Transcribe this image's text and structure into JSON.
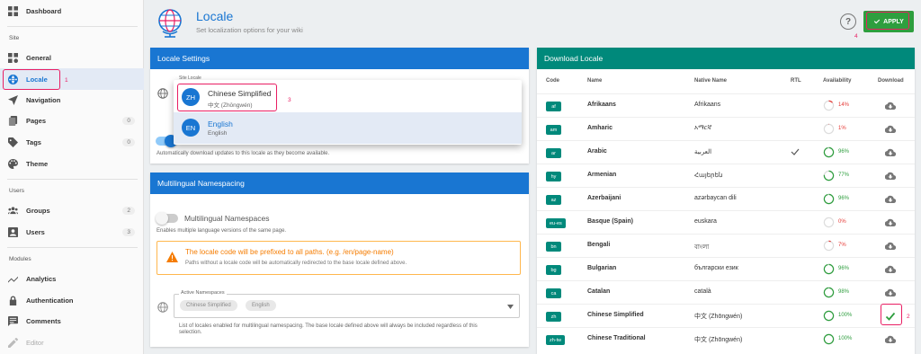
{
  "sidebar": {
    "dashboard": "Dashboard",
    "site_label": "Site",
    "general": "General",
    "locale": "Locale",
    "navigation": "Navigation",
    "pages": "Pages",
    "pages_count": "0",
    "tags": "Tags",
    "tags_count": "0",
    "theme": "Theme",
    "users_label": "Users",
    "groups": "Groups",
    "groups_count": "2",
    "users": "Users",
    "users_count": "3",
    "modules_label": "Modules",
    "analytics": "Analytics",
    "authentication": "Authentication",
    "comments": "Comments",
    "editor": "Editor"
  },
  "header": {
    "title": "Locale",
    "subtitle": "Set localization options for your wiki",
    "help": "?",
    "apply": "APPLY"
  },
  "annotations": {
    "one": "1",
    "two": "2",
    "three": "3",
    "four": "4"
  },
  "locale_settings": {
    "title": "Locale Settings",
    "field_label": "Site Locale",
    "auto_update_hint": "Automatically download updates to this locale as they become available."
  },
  "dropdown": {
    "items": [
      {
        "avatar": "ZH",
        "name": "Chinese Simplified",
        "native": "中文 (Zhōngwén)"
      },
      {
        "avatar": "EN",
        "name": "English",
        "native": "English"
      }
    ]
  },
  "namespacing": {
    "title": "Multilingual Namespacing",
    "toggle_label": "Multilingual Namespaces",
    "toggle_hint": "Enables multiple language versions of the same page.",
    "warning_title": "The locale code will be prefixed to all paths. (e.g. /en/page-name)",
    "warning_sub": "Paths without a locale code will be automatically redirected to the base locale defined above.",
    "active_label": "Active Namespaces",
    "chips": [
      "Chinese Simplified",
      "English"
    ],
    "hint_line1": "List of locales enabled for multilingual namespacing. The base locale defined above will always be included regardless of this",
    "hint_line2": "selection."
  },
  "download": {
    "title": "Download Locale",
    "columns": [
      "Code",
      "Name",
      "Native Name",
      "RTL",
      "Availability",
      "Download"
    ],
    "rows": [
      {
        "code": "af",
        "name": "Afrikaans",
        "native": "Afrikaans",
        "rtl": false,
        "availability": "14%",
        "pct": 14,
        "installed": false
      },
      {
        "code": "am",
        "name": "Amharic",
        "native": "አማርኛ",
        "rtl": false,
        "availability": "1%",
        "pct": 1,
        "installed": false
      },
      {
        "code": "ar",
        "name": "Arabic",
        "native": "العربية",
        "rtl": true,
        "availability": "96%",
        "pct": 96,
        "installed": false
      },
      {
        "code": "hy",
        "name": "Armenian",
        "native": "Հայերեն",
        "rtl": false,
        "availability": "77%",
        "pct": 77,
        "installed": false
      },
      {
        "code": "az",
        "name": "Azerbaijani",
        "native": "azərbaycan dili",
        "rtl": false,
        "availability": "96%",
        "pct": 96,
        "installed": false
      },
      {
        "code": "eu-es",
        "name": "Basque (Spain)",
        "native": "euskara",
        "rtl": false,
        "availability": "0%",
        "pct": 0,
        "installed": false
      },
      {
        "code": "bn",
        "name": "Bengali",
        "native": "বাংলা",
        "rtl": false,
        "availability": "7%",
        "pct": 7,
        "installed": false
      },
      {
        "code": "bg",
        "name": "Bulgarian",
        "native": "български език",
        "rtl": false,
        "availability": "96%",
        "pct": 96,
        "installed": false
      },
      {
        "code": "ca",
        "name": "Catalan",
        "native": "català",
        "rtl": false,
        "availability": "98%",
        "pct": 98,
        "installed": false
      },
      {
        "code": "zh",
        "name": "Chinese Simplified",
        "native": "中文 (Zhōngwén)",
        "rtl": false,
        "availability": "100%",
        "pct": 100,
        "installed": true
      },
      {
        "code": "zh-tw",
        "name": "Chinese Traditional",
        "native": "中文 (Zhōngwén)",
        "rtl": false,
        "availability": "100%",
        "pct": 100,
        "installed": false
      }
    ]
  },
  "colors": {
    "primary": "#1976d2",
    "teal": "#00897b",
    "green": "#2e9e3e",
    "low": "#e53935",
    "highlight": "#e91e63"
  }
}
